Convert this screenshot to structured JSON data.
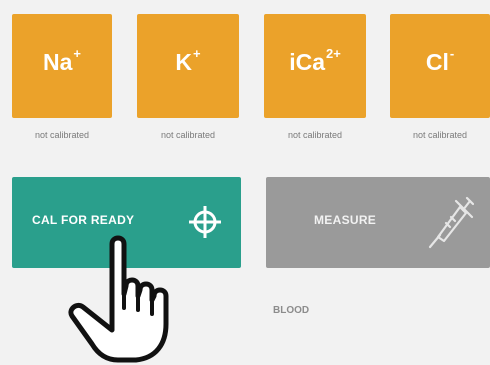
{
  "electrolytes": [
    {
      "symbol": "Na",
      "charge": "+",
      "status": "not calibrated"
    },
    {
      "symbol": "K",
      "charge": "+",
      "status": "not calibrated"
    },
    {
      "symbol": "iCa",
      "charge": "2+",
      "status": "not calibrated"
    },
    {
      "symbol": "Cl",
      "charge": "-",
      "status": "not calibrated"
    }
  ],
  "actions": {
    "cal_label": "CAL FOR READY",
    "measure_label": "MEASURE"
  },
  "sample": {
    "caption": "",
    "value": "BLOOD"
  },
  "icons": {
    "cal": "crosshair-icon",
    "measure": "syringe-icon",
    "cursor": "hand-pointer-icon"
  },
  "colors": {
    "tile": "#eba22a",
    "cal_button": "#2a9f8c",
    "measure_button": "#9a9a9a",
    "background": "#f2f2f2"
  }
}
